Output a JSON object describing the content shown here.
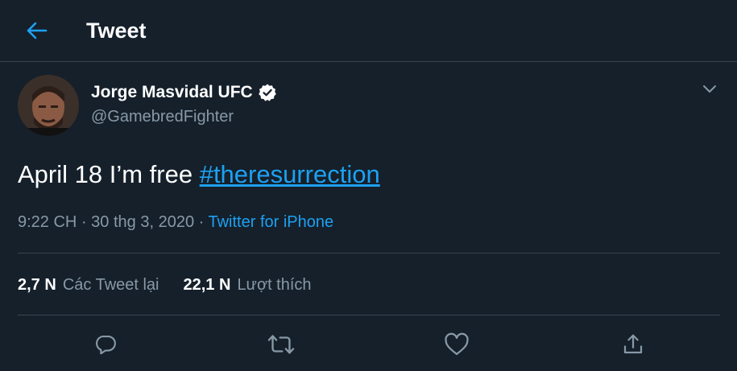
{
  "header": {
    "title": "Tweet",
    "back_icon": "arrow-left-icon"
  },
  "tweet": {
    "author_name": "Jorge Masvidal UFC",
    "verified_icon": "verified-badge-icon",
    "handle": "@GamebredFighter",
    "text": "April 18 I’m free ",
    "hashtag": "#theresurrection",
    "time": "9:22 CH",
    "separator": "·",
    "date": "30 thg 3, 2020",
    "source": "Twitter for iPhone"
  },
  "stats": {
    "retweets_count": "2,7 N",
    "retweets_label": "Các Tweet lại",
    "likes_count": "22,1 N",
    "likes_label": "Lượt thích"
  },
  "actions": [
    "reply-icon",
    "retweet-icon",
    "like-icon",
    "share-icon"
  ],
  "colors": {
    "background": "#15202b",
    "accent": "#1da1f2",
    "muted_text": "#8899a6",
    "border": "#38444d"
  }
}
